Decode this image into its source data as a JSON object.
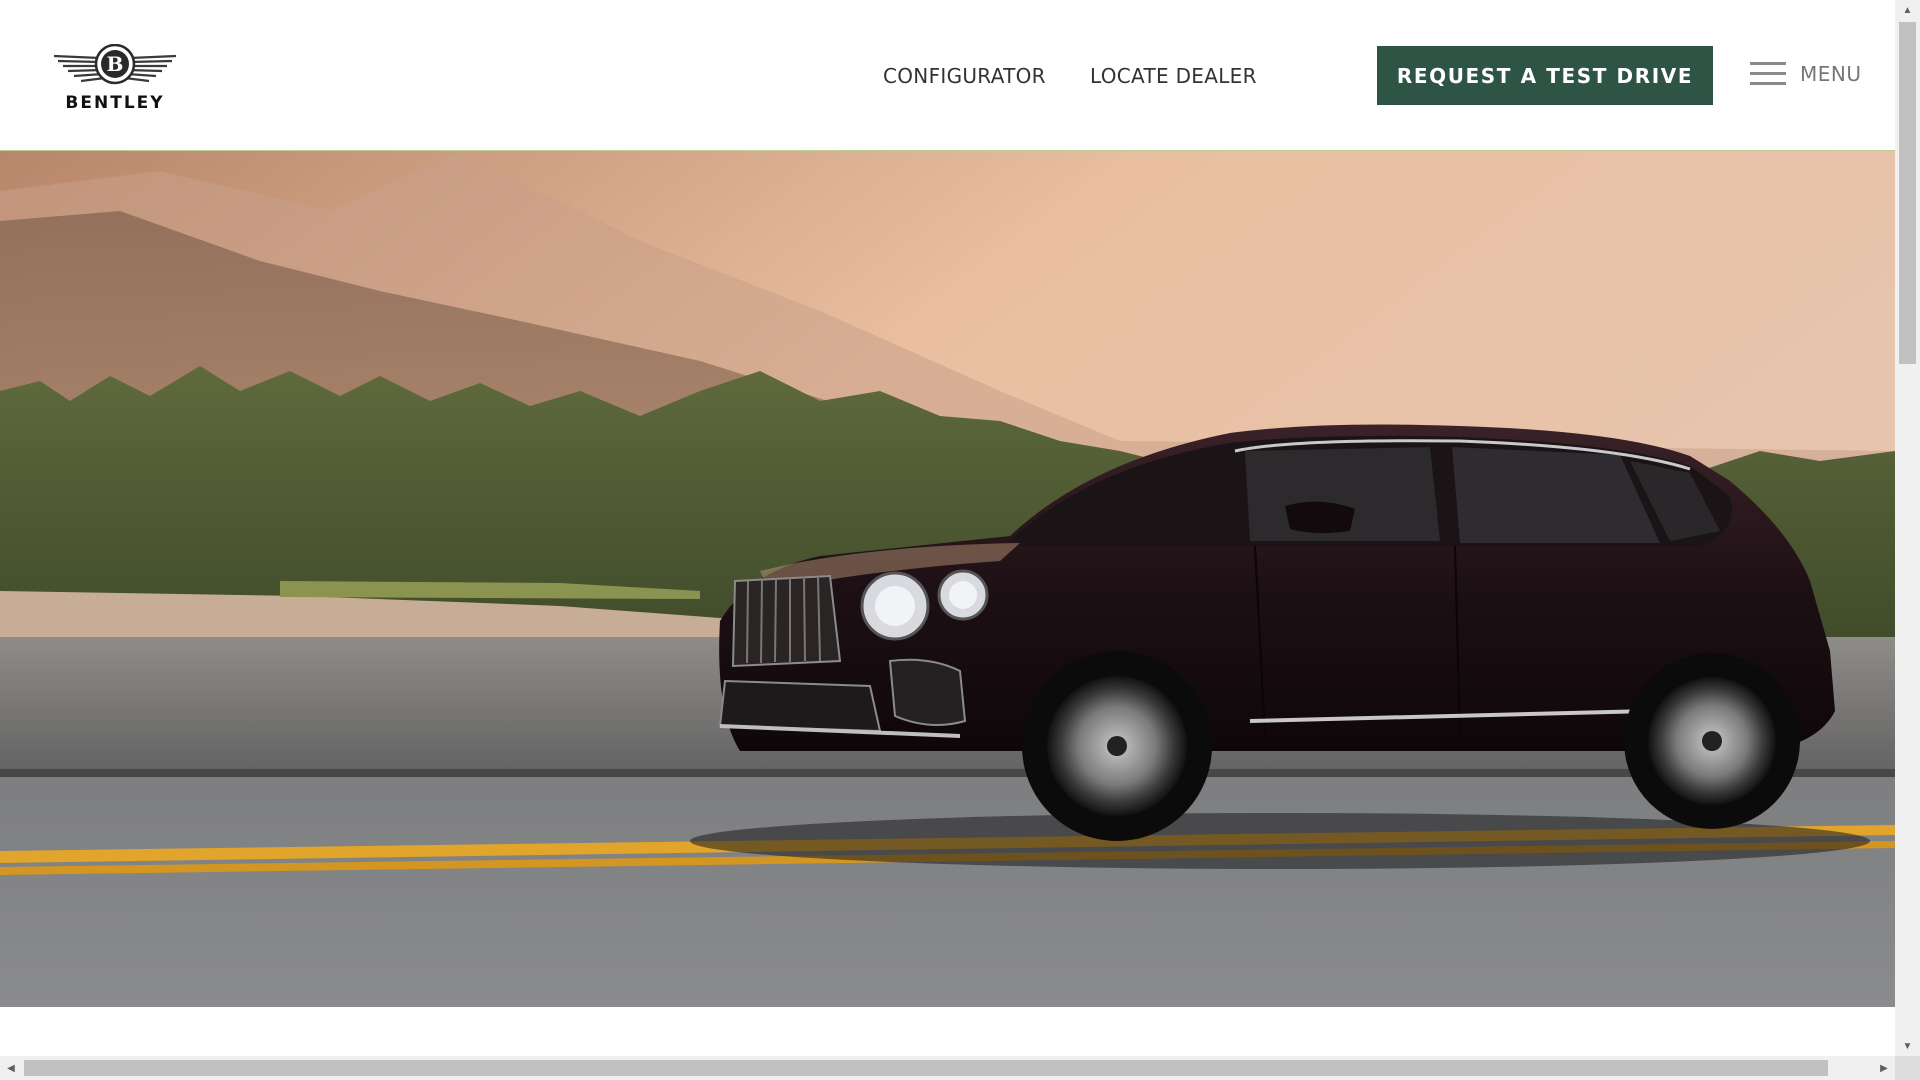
{
  "brand": {
    "name": "BENTLEY"
  },
  "nav": {
    "configurator": "CONFIGURATOR",
    "locate_dealer": "LOCATE DEALER"
  },
  "cta": {
    "label": "REQUEST A TEST DRIVE"
  },
  "menu": {
    "label": "MENU",
    "icon": "hamburger-icon"
  },
  "hero": {
    "image": "Dark Bentley Bentayga SUV driving on a highway with misty forested mountains at sunset"
  },
  "scrollbars": {
    "vertical": "up-arrow / down-arrow",
    "horizontal": "left-arrow / right-arrow"
  },
  "colors": {
    "cta_background": "#2e5446",
    "header_border": "#b9cf9a",
    "road_line": "#e0a52a"
  }
}
